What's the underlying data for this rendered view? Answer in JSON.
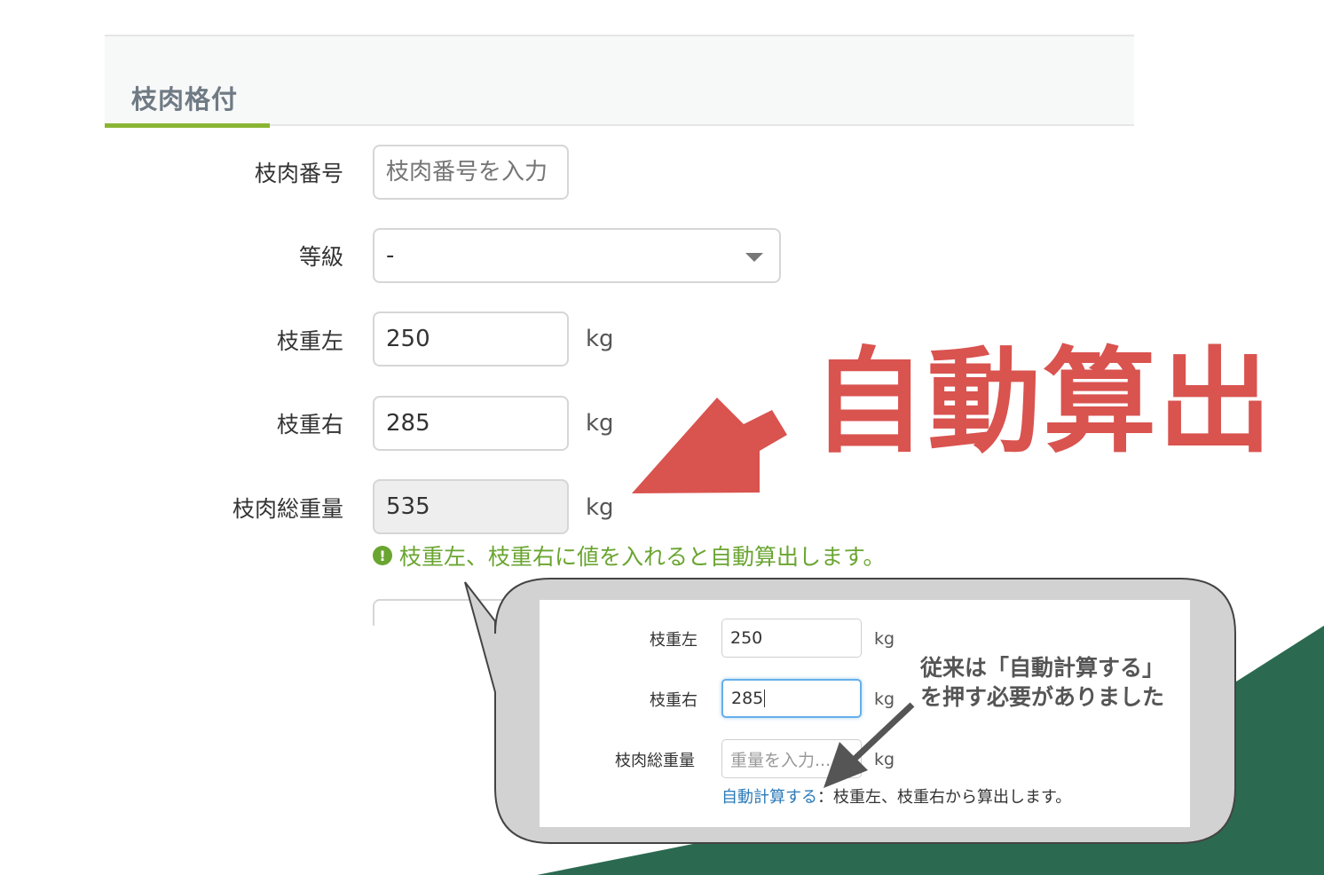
{
  "panel": {
    "title": "枝肉格付"
  },
  "form": {
    "carcass_number": {
      "label": "枝肉番号",
      "placeholder": "枝肉番号を入力"
    },
    "grade": {
      "label": "等級",
      "value": "-"
    },
    "weight_left": {
      "label": "枝重左",
      "value": "250",
      "unit": "kg"
    },
    "weight_right": {
      "label": "枝重右",
      "value": "285",
      "unit": "kg"
    },
    "total_weight": {
      "label": "枝肉総重量",
      "value": "535",
      "unit": "kg"
    },
    "hint": "枝重左、枝重右に値を入れると自動算出します。"
  },
  "annotation": {
    "big_text": "自動算出"
  },
  "old_ui": {
    "weight_left": {
      "label": "枝重左",
      "value": "250",
      "unit": "kg"
    },
    "weight_right": {
      "label": "枝重右",
      "value": "285",
      "unit": "kg"
    },
    "total_weight": {
      "label": "枝肉総重量",
      "placeholder": "重量を入力...",
      "unit": "kg"
    },
    "auto_calc_link": "自動計算する",
    "auto_calc_note": "：枝重左、枝重右から算出します。",
    "callout_line1": "従来は「自動計算する」",
    "callout_line2": "を押す必要がありました"
  },
  "colors": {
    "accent_green": "#8ab534",
    "hint_green": "#6aa531",
    "annotation_red": "#d9534f",
    "corner_green": "#2b6a50",
    "link_blue": "#2a7ab8"
  }
}
